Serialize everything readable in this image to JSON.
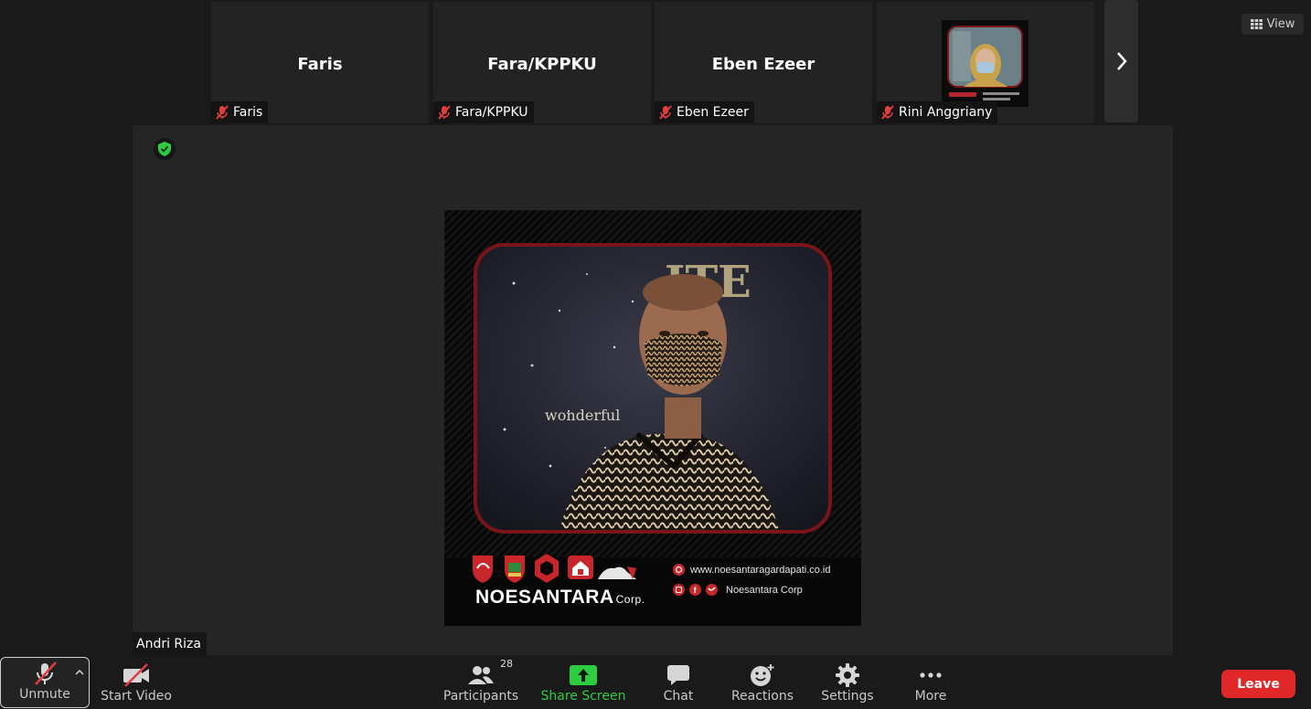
{
  "gallery": {
    "tiles": [
      {
        "display_name": "Faris",
        "label": "Faris"
      },
      {
        "display_name": "Fara/KPPKU",
        "label": "Fara/KPPKU"
      },
      {
        "display_name": "Eben Ezeer",
        "label": "Eben Ezeer"
      },
      {
        "display_name": "",
        "label": "Rini Anggriany"
      }
    ]
  },
  "view_button": {
    "label": "View"
  },
  "main_speaker": {
    "name": "Andri Riza"
  },
  "shared_image": {
    "brand_name": "NOESANTARA",
    "brand_suffix": "Corp.",
    "website": "www.noesantaragardapati.co.id",
    "social_handle": "Noesantara Corp",
    "photo_text": "wonderful"
  },
  "toolbar": {
    "unmute_label": "Unmute",
    "start_video_label": "Start Video",
    "participants_label": "Participants",
    "participants_count": "28",
    "share_screen_label": "Share Screen",
    "chat_label": "Chat",
    "reactions_label": "Reactions",
    "settings_label": "Settings",
    "more_label": "More",
    "leave_label": "Leave"
  },
  "colors": {
    "accent_green": "#2ecc40",
    "leave_red": "#e02828",
    "muted_red": "#e23c3c",
    "frame_red": "#7a1418"
  }
}
